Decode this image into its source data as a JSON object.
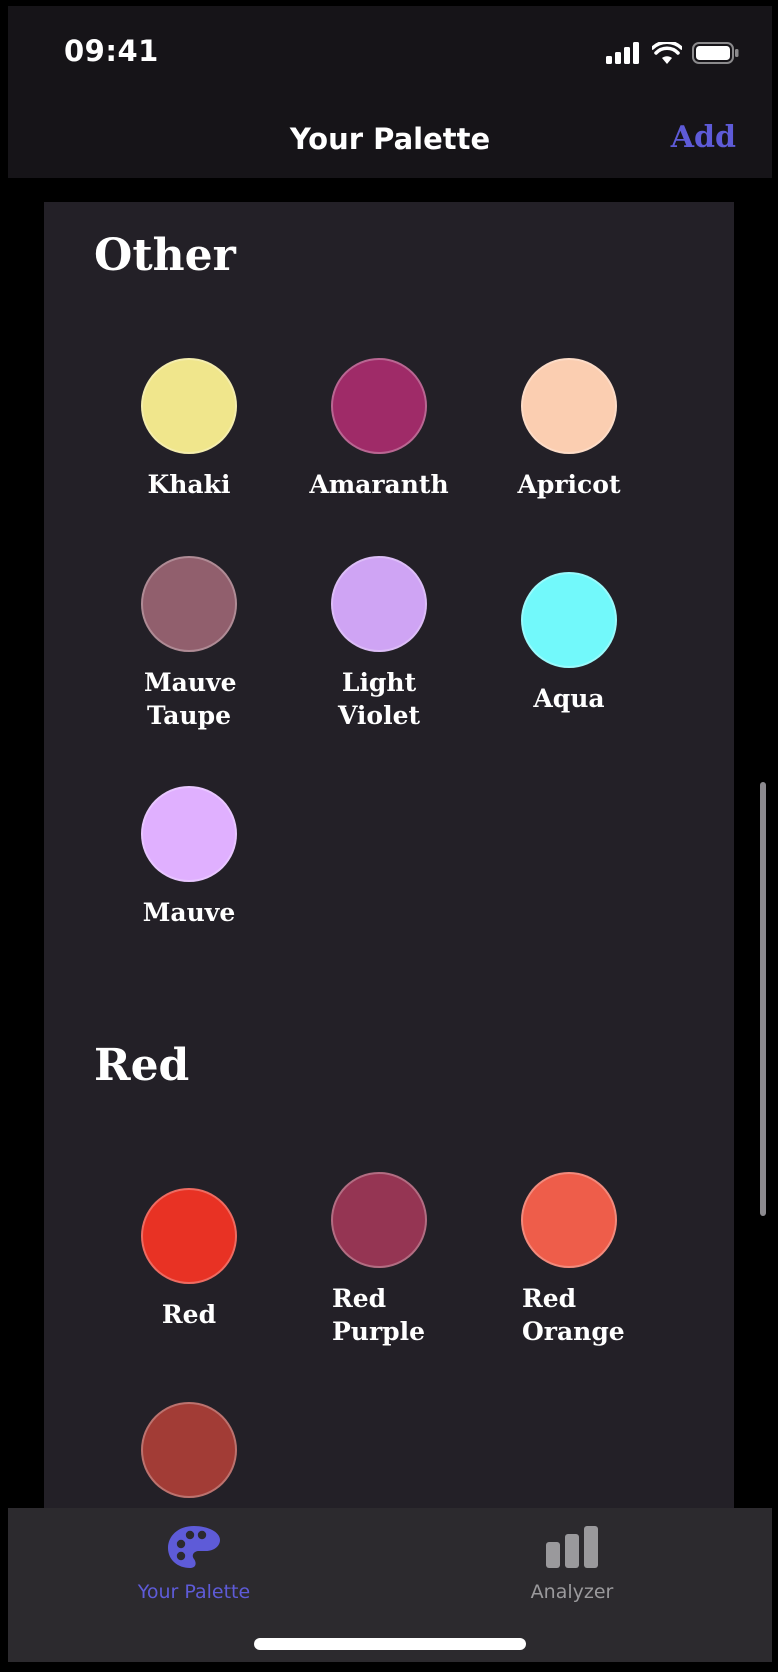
{
  "status_bar": {
    "time": "09:41"
  },
  "nav": {
    "title": "Your Palette",
    "add_label": "Add"
  },
  "sections": [
    {
      "title": "Other",
      "swatches": [
        {
          "name": "Khaki",
          "color": "#F0E68C"
        },
        {
          "name": "Amaranth",
          "color": "#9F2B68"
        },
        {
          "name": "Apricot",
          "color": "#FBCEB1"
        },
        {
          "name": "Mauve Taupe",
          "color": "#915F6D"
        },
        {
          "name": "Light Violet",
          "color": "#CFA4F4"
        },
        {
          "name": "Aqua",
          "color": "#72F9FB"
        },
        {
          "name": "Mauve",
          "color": "#E0B0FF"
        }
      ]
    },
    {
      "title": "Red",
      "swatches": [
        {
          "name": "Red",
          "color": "#E83224"
        },
        {
          "name": "Red Purple",
          "color": "#953553"
        },
        {
          "name": "Red Orange",
          "color": "#EE5D4A"
        },
        {
          "name": "",
          "color": "#A23C36"
        }
      ]
    }
  ],
  "tabs": [
    {
      "label": "Your Palette",
      "icon": "palette-icon",
      "active": true,
      "color": "#5e5bd8"
    },
    {
      "label": "Analyzer",
      "icon": "bar-chart-icon",
      "active": false,
      "color": "#9a999c"
    }
  ]
}
